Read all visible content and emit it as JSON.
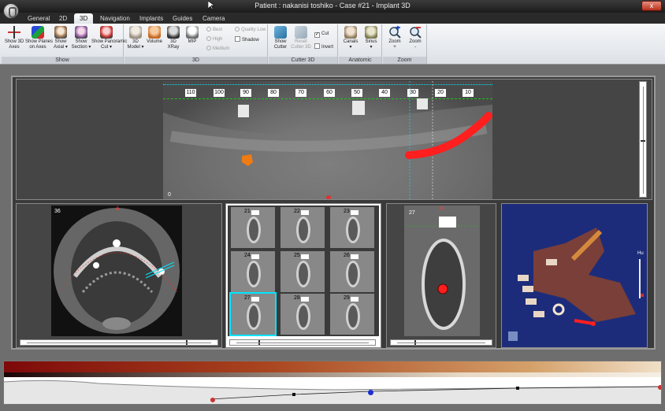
{
  "window": {
    "title": "Patient : nakanisi toshiko - Case #21 - Implant 3D",
    "close_label": "x"
  },
  "tabs": [
    {
      "label": "General",
      "active": false
    },
    {
      "label": "2D",
      "active": false
    },
    {
      "label": "3D",
      "active": true
    },
    {
      "label": "Navigation",
      "active": false
    },
    {
      "label": "Implants",
      "active": false
    },
    {
      "label": "Guides",
      "active": false
    },
    {
      "label": "Camera",
      "active": false
    }
  ],
  "ribbon": {
    "show": {
      "label": "Show",
      "buttons": [
        {
          "line1": "Show 3D",
          "line2": "Axes",
          "icon": "axes-icon"
        },
        {
          "line1": "Show Planes",
          "line2": "on Axes",
          "icon": "planes-icon"
        },
        {
          "line1": "Show",
          "line2": "Axial ▾",
          "icon": "axial-icon"
        },
        {
          "line1": "Show",
          "line2": "Section ▾",
          "icon": "section-icon"
        },
        {
          "line1": "Show Panoramic",
          "line2": "Cut ▾",
          "icon": "panoramic-icon"
        }
      ]
    },
    "three_d": {
      "label": "3D",
      "buttons": [
        {
          "line1": "3D",
          "line2": "Model ▾",
          "icon": "skull-model-icon"
        },
        {
          "line1": "Volume",
          "line2": "",
          "icon": "skull-volume-icon"
        },
        {
          "line1": "3D",
          "line2": "XRay",
          "icon": "skull-xray-icon"
        },
        {
          "line1": "MIP",
          "line2": "",
          "icon": "skull-mip-icon"
        }
      ],
      "options": [
        "Best",
        "High",
        "Medium",
        "Quality Low",
        "Shadow"
      ]
    },
    "cutter": {
      "label": "Cutter 3D",
      "buttons": [
        {
          "line1": "Show",
          "line2": "Cutter",
          "icon": "cutter-icon"
        },
        {
          "line1": "Reset",
          "line2": "Cutter 3D",
          "icon": "reset-cutter-icon"
        }
      ],
      "options": [
        "Cut",
        "Invert"
      ]
    },
    "anatomic": {
      "label": "Anatomic",
      "buttons": [
        {
          "line1": "Canals",
          "line2": "▾",
          "icon": "canals-icon"
        },
        {
          "line1": "Sinus",
          "line2": "▾",
          "icon": "sinus-icon"
        }
      ]
    },
    "zoom": {
      "label": "Zoom",
      "buttons": [
        {
          "line1": "Zoom",
          "line2": "+",
          "icon": "zoom-in-icon"
        },
        {
          "line1": "Zoom",
          "line2": "-",
          "icon": "zoom-out-icon"
        }
      ]
    }
  },
  "panoramic": {
    "ruler": [
      "110",
      "100",
      "90",
      "80",
      "70",
      "60",
      "50",
      "40",
      "30",
      "20",
      "10"
    ],
    "corner_label": "0"
  },
  "axial": {
    "slice": "36",
    "marker": "A"
  },
  "sections": {
    "thumbs": [
      "21",
      "22",
      "23",
      "24",
      "25",
      "26",
      "27",
      "28",
      "29"
    ],
    "selected": "27"
  },
  "cross_section": {
    "slice": "27",
    "top_marker": "B"
  },
  "render3d": {
    "legend": "Hu"
  },
  "colors": {
    "accent_selection": "#00e5ff",
    "nerve_canal": "#ff1f1f",
    "orange_marker": "#f07b12"
  }
}
